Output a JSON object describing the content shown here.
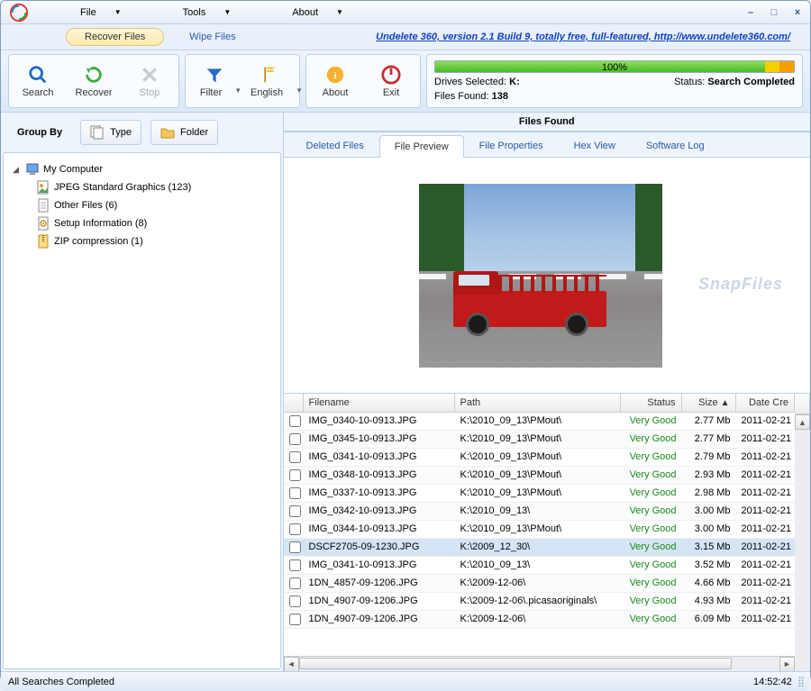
{
  "menu": {
    "file": "File",
    "tools": "Tools",
    "about": "About"
  },
  "topTabs": {
    "recover": "Recover Files",
    "wipe": "Wipe Files"
  },
  "link": "Undelete 360, version 2.1 Build 9, totally free, full-featured, http://www.undelete360.com/",
  "toolbar": {
    "search": "Search",
    "recover": "Recover",
    "stop": "Stop",
    "filter": "Filter",
    "english": "English",
    "about": "About",
    "exit": "Exit"
  },
  "status": {
    "progress": "100%",
    "drives_label": "Drives Selected:",
    "drives_val": "K:",
    "found_label": "Files Found:",
    "found_val": "138",
    "status_label": "Status:",
    "status_val": "Search Completed"
  },
  "groupby": {
    "label": "Group By",
    "type": "Type",
    "folder": "Folder"
  },
  "tree": {
    "root": "My Computer",
    "items": [
      {
        "icon": "jpeg",
        "label": "JPEG Standard Graphics (123)"
      },
      {
        "icon": "other",
        "label": "Other Files (6)"
      },
      {
        "icon": "setup",
        "label": "Setup Information (8)"
      },
      {
        "icon": "zip",
        "label": "ZIP compression (1)"
      }
    ]
  },
  "filesFound": "Files Found",
  "contentTabs": {
    "deleted": "Deleted Files",
    "preview": "File Preview",
    "properties": "File Properties",
    "hex": "Hex View",
    "log": "Software Log"
  },
  "watermark": "SnapFiles",
  "gridHeaders": {
    "filename": "Filename",
    "path": "Path",
    "status": "Status",
    "size": "Size",
    "date": "Date Cre"
  },
  "rows": [
    {
      "fn": "IMG_0340-10-0913.JPG",
      "path": "K:\\2010_09_13\\PMout\\",
      "status": "Very Good",
      "size": "2.77 Mb",
      "date": "2011-02-21"
    },
    {
      "fn": "IMG_0345-10-0913.JPG",
      "path": "K:\\2010_09_13\\PMout\\",
      "status": "Very Good",
      "size": "2.77 Mb",
      "date": "2011-02-21"
    },
    {
      "fn": "IMG_0341-10-0913.JPG",
      "path": "K:\\2010_09_13\\PMout\\",
      "status": "Very Good",
      "size": "2.79 Mb",
      "date": "2011-02-21"
    },
    {
      "fn": "IMG_0348-10-0913.JPG",
      "path": "K:\\2010_09_13\\PMout\\",
      "status": "Very Good",
      "size": "2.93 Mb",
      "date": "2011-02-21"
    },
    {
      "fn": "IMG_0337-10-0913.JPG",
      "path": "K:\\2010_09_13\\PMout\\",
      "status": "Very Good",
      "size": "2.98 Mb",
      "date": "2011-02-21"
    },
    {
      "fn": "IMG_0342-10-0913.JPG",
      "path": "K:\\2010_09_13\\",
      "status": "Very Good",
      "size": "3.00 Mb",
      "date": "2011-02-21"
    },
    {
      "fn": "IMG_0344-10-0913.JPG",
      "path": "K:\\2010_09_13\\PMout\\",
      "status": "Very Good",
      "size": "3.00 Mb",
      "date": "2011-02-21"
    },
    {
      "fn": "DSCF2705-09-1230.JPG",
      "path": "K:\\2009_12_30\\",
      "status": "Very Good",
      "size": "3.15 Mb",
      "date": "2011-02-21",
      "sel": true
    },
    {
      "fn": "IMG_0341-10-0913.JPG",
      "path": "K:\\2010_09_13\\",
      "status": "Very Good",
      "size": "3.52 Mb",
      "date": "2011-02-21"
    },
    {
      "fn": "1DN_4857-09-1206.JPG",
      "path": "K:\\2009-12-06\\",
      "status": "Very Good",
      "size": "4.66 Mb",
      "date": "2011-02-21"
    },
    {
      "fn": "1DN_4907-09-1206.JPG",
      "path": "K:\\2009-12-06\\.picasaoriginals\\",
      "status": "Very Good",
      "size": "4.93 Mb",
      "date": "2011-02-21"
    },
    {
      "fn": "1DN_4907-09-1206.JPG",
      "path": "K:\\2009-12-06\\",
      "status": "Very Good",
      "size": "6.09 Mb",
      "date": "2011-02-21"
    }
  ],
  "statusbar": {
    "left": "All Searches Completed",
    "time": "14:52:42"
  }
}
